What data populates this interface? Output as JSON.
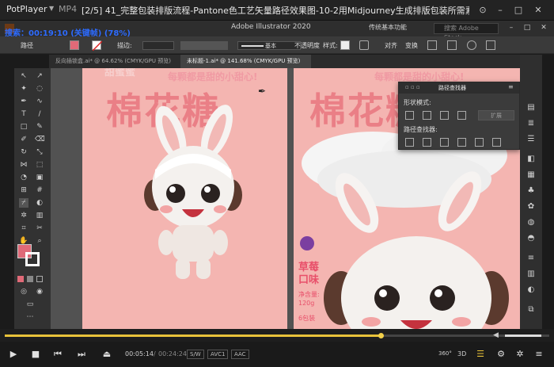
{
  "player": {
    "brand": "PotPlayer",
    "format": "MP4",
    "file_title": "[2/5] 41_完整包装排版流程-Pantone色工艺矢量路径效果图-10-2用Midjourney生成排版包装所需素材.m",
    "overlay_text": "搜索：00:19:10 (关键帧) (78%)",
    "time_current": "00:05:14",
    "time_total": "00:24:24",
    "codec_chips": [
      "S/W",
      "AVC1",
      "AAC"
    ],
    "progress_fraction": 0.69,
    "volume_fraction": 0.85,
    "badge_360": "360°",
    "badge_3d": "3D"
  },
  "illustrator": {
    "app_title": "Adobe Illustrator 2020",
    "workspace": "传统基本功能",
    "search_placeholder": "搜索 Adobe Stock",
    "control_bar": {
      "path_label": "路径",
      "stroke_label": "描边:",
      "stroke_style": "基本",
      "opacity_label": "不透明度",
      "style_label": "样式:",
      "align_label": "对齐",
      "transform_label": "变换"
    },
    "tabs": [
      {
        "label": "反向插锁盒.ai* @ 64.62% (CMYK/GPU 预览)",
        "active": false
      },
      {
        "label": "未标题-1.ai* @ 141.68% (CMYK/GPU 预览)",
        "active": true
      }
    ],
    "pathfinder": {
      "title": "路径查找器",
      "shape_modes_label": "形状模式:",
      "pathfinders_label": "路径查找器:",
      "expand_label": "扩展"
    },
    "artboard": {
      "title_text": "棉花糖",
      "slogan": "每颗都是甜的小甜心!",
      "top_text": "甜蜜蜜",
      "flavor": "草莓口味",
      "net_weight_label": "净含量:",
      "net_weight_value": "120g",
      "pack_count": "6包装"
    },
    "colors": {
      "fill": "#e06a78",
      "artboard_pink": "#f4b5b1",
      "title_pink": "#ea7f86",
      "flavor_pink": "#e8506a"
    }
  }
}
